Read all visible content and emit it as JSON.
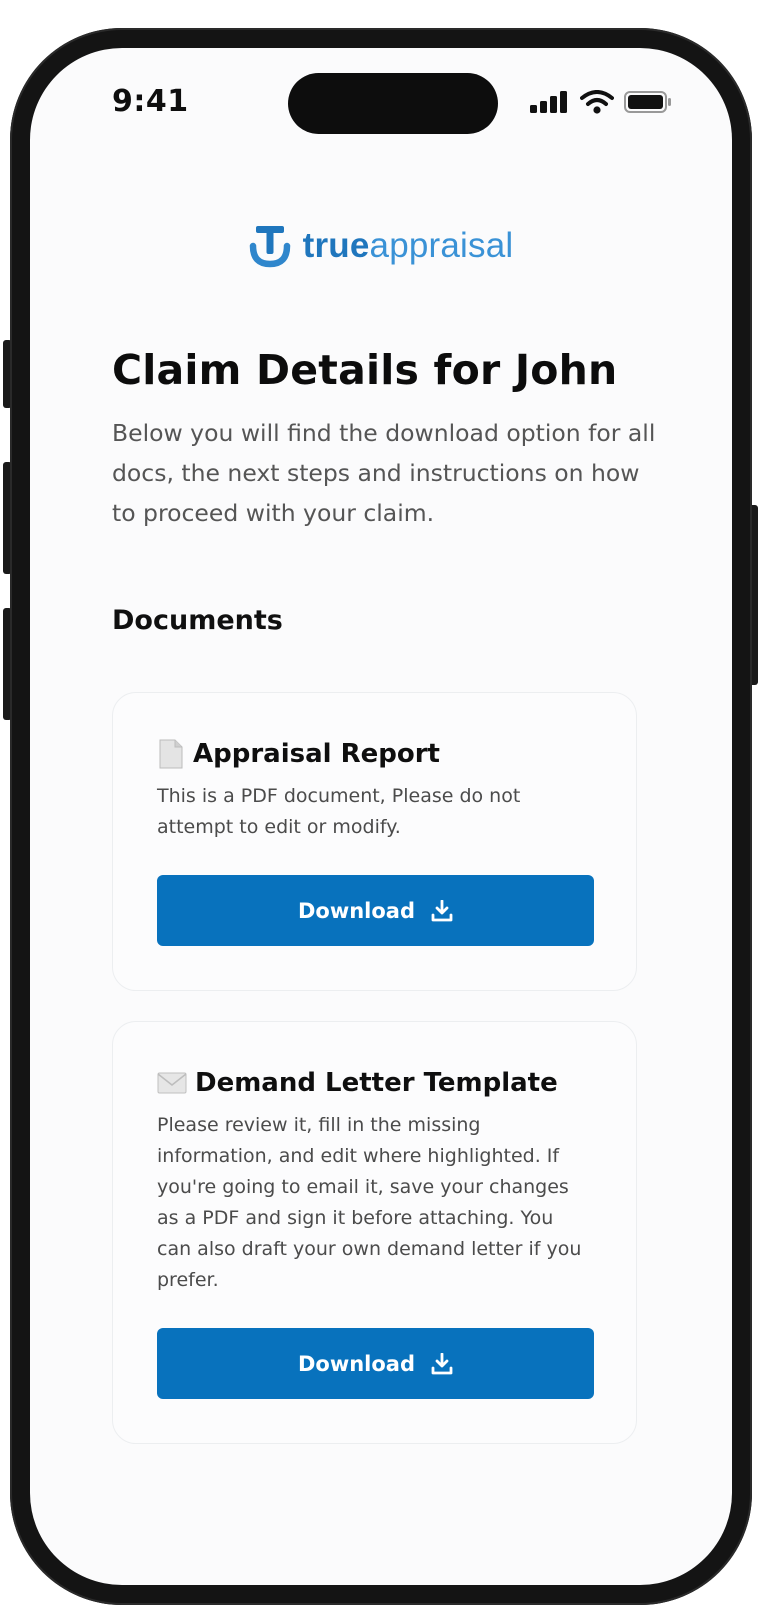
{
  "status_bar": {
    "time": "9:41"
  },
  "brand": {
    "name_bold": "true",
    "name_light": "appraisal",
    "logo_icon": "t-anchor-logo-icon",
    "color": "#2f86cc"
  },
  "page": {
    "title": "Claim Details for John",
    "intro": "Below you will find the download option for all docs, the next steps and instructions on how to proceed with your claim."
  },
  "documents": {
    "section_title": "Documents",
    "items": [
      {
        "icon": "document-icon",
        "title": "Appraisal Report",
        "description": "This is a PDF document, Please do not attempt to edit or modify.",
        "button_label": "Download"
      },
      {
        "icon": "envelope-icon",
        "title": "Demand Letter Template",
        "description": "Please review it, fill in the missing information, and edit where highlighted. If you're going to email it, save your changes as a PDF and sign it before attaching. You can also draft your own demand letter if you prefer.",
        "button_label": "Download"
      }
    ]
  },
  "colors": {
    "accent": "#0872bd",
    "background": "#fbfbfc",
    "text": "#0c0c0c"
  }
}
